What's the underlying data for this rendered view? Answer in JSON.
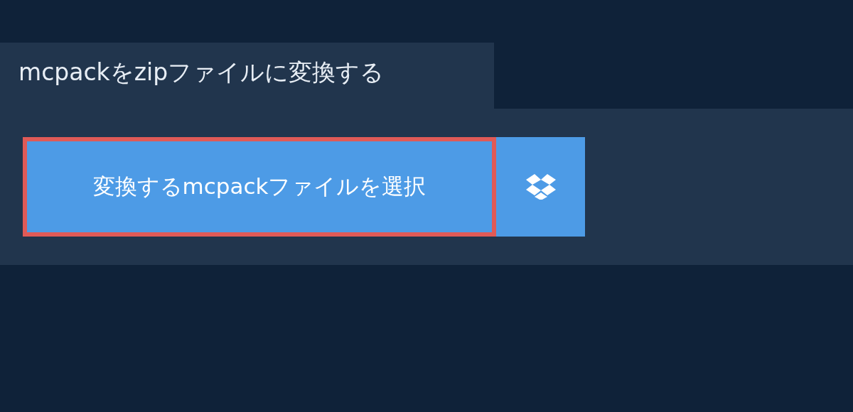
{
  "tab": {
    "label": "mcpackをzipファイルに変換する"
  },
  "select_button": {
    "label": "変換するmcpackファイルを選択",
    "focused": true
  }
}
